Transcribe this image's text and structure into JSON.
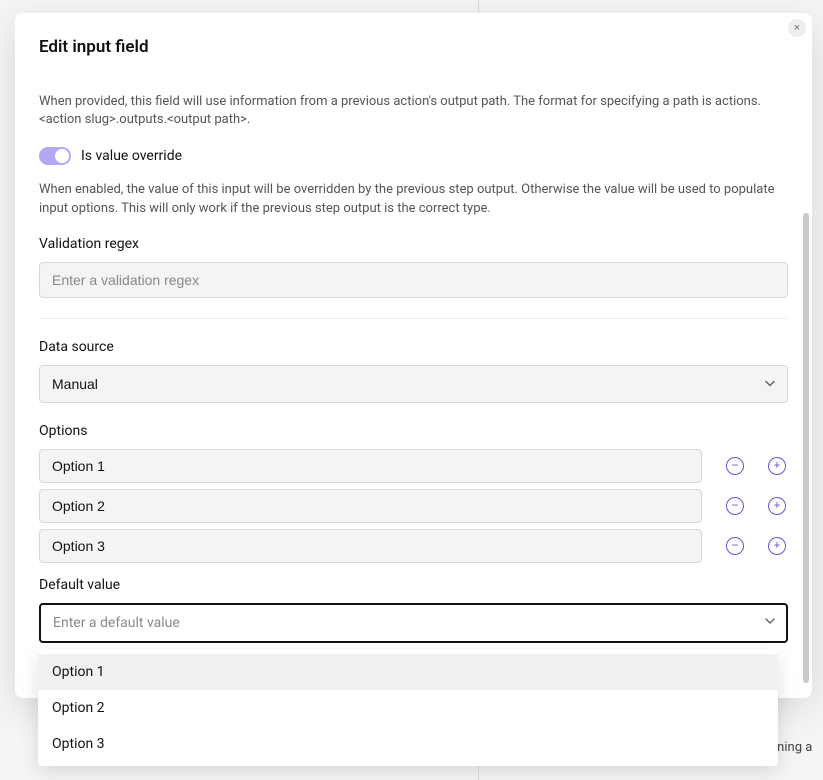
{
  "background": {
    "partial_text": "nning a"
  },
  "modal": {
    "title": "Edit input field",
    "close_glyph": "×",
    "intro_text": "When provided, this field will use information from a previous action's output path. The format for specifying a path is actions.<action slug>.outputs.<output path>.",
    "toggle": {
      "label": "Is value override",
      "enabled": true,
      "help": "When enabled, the value of this input will be overridden by the previous step output. Otherwise the value will be used to populate input options. This will only work if the previous step output is the correct type."
    },
    "validation": {
      "label": "Validation regex",
      "placeholder": "Enter a validation regex",
      "value": ""
    },
    "data_source": {
      "label": "Data source",
      "selected": "Manual"
    },
    "options_section": {
      "label": "Options",
      "rows": [
        {
          "value": "Option 1"
        },
        {
          "value": "Option 2"
        },
        {
          "value": "Option 3"
        }
      ],
      "remove_glyph": "−",
      "add_glyph": "+"
    },
    "default_value": {
      "label": "Default value",
      "placeholder": "Enter a default value",
      "dropdown_open": true,
      "dropdown_items": [
        "Option 1",
        "Option 2",
        "Option 3"
      ],
      "hover_index": 0
    }
  }
}
